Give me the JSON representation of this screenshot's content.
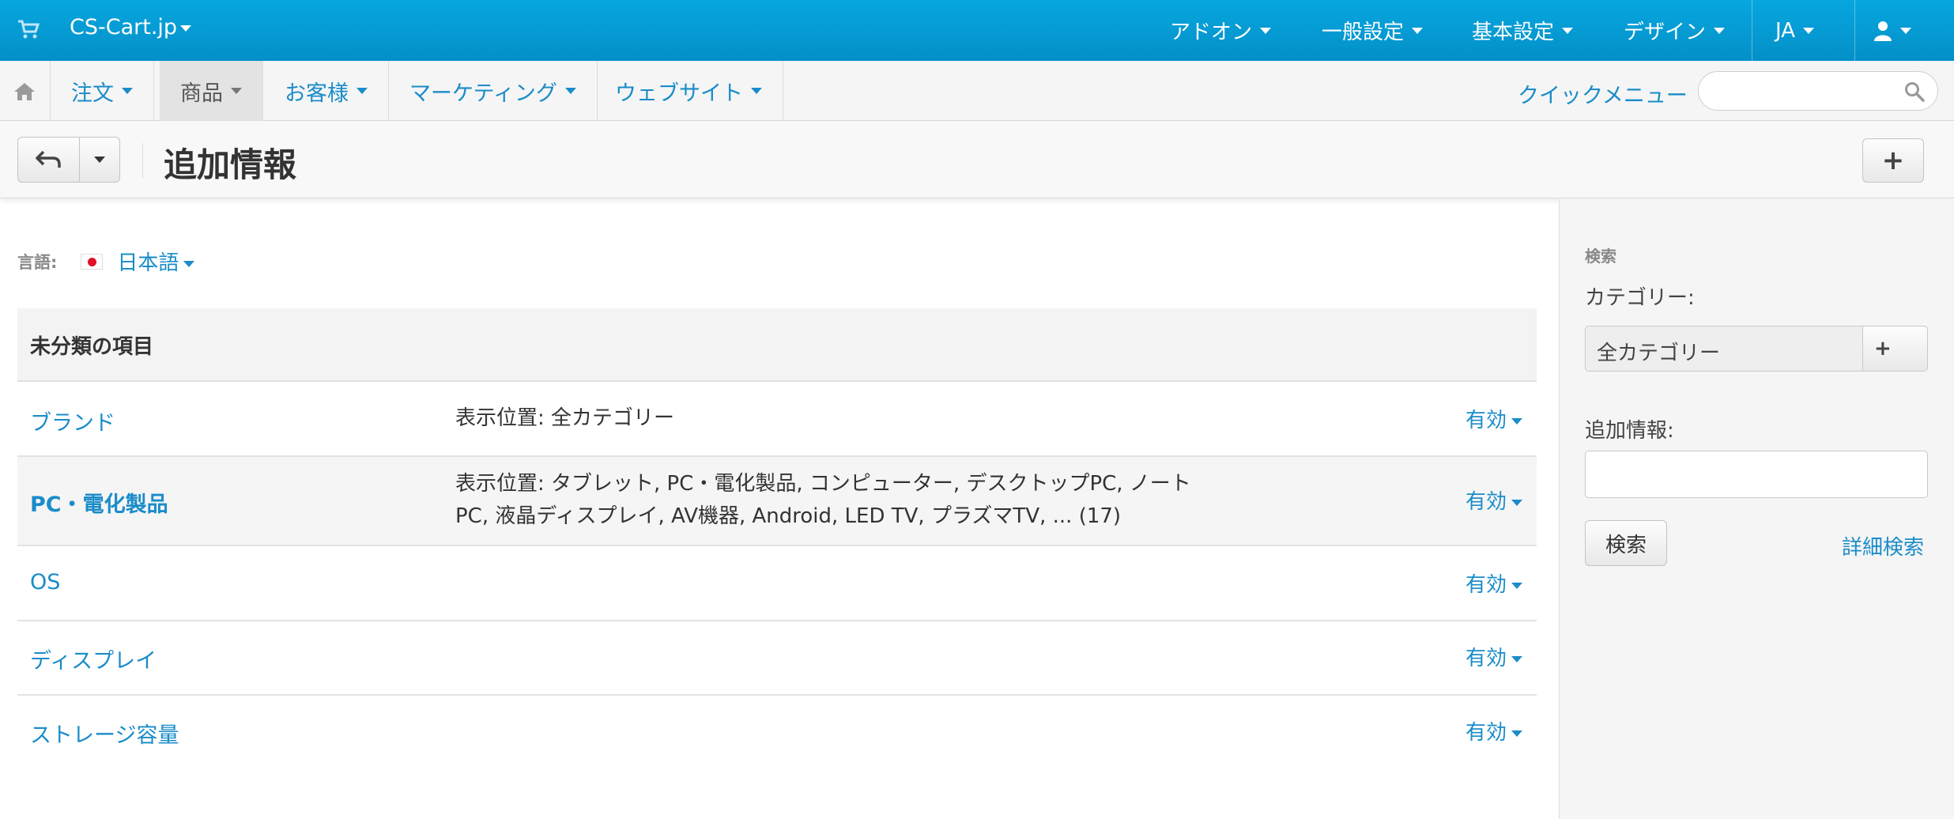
{
  "topbar": {
    "store_name": "CS-Cart.jp",
    "menu": [
      "アドオン",
      "一般設定",
      "基本設定",
      "デザイン"
    ],
    "language": "JA",
    "colors": {
      "bar": "#0490c8",
      "link": "#1a8cc9"
    }
  },
  "navbar": {
    "items": [
      "注文",
      "商品",
      "お客様",
      "マーケティング",
      "ウェブサイト"
    ],
    "active": "商品",
    "quick_menu": "クイックメニュー",
    "search_placeholder": ""
  },
  "page": {
    "title": "追加情報"
  },
  "language_selector": {
    "label": "言語:",
    "value": "日本語"
  },
  "group": {
    "header": "未分類の項目",
    "rows": [
      {
        "name": "ブランド",
        "position": "表示位置: 全カテゴリー",
        "status": "有効"
      },
      {
        "name": "PC・電化製品",
        "position": "表示位置: タブレット, PC・電化製品, コンピューター, デスクトップPC, ノートPC, 液晶ディスプレイ, AV機器, Android, LED TV, プラズマTV, ... (17)",
        "status": "有効"
      },
      {
        "name": "OS",
        "position": "",
        "status": "有効"
      },
      {
        "name": "ディスプレイ",
        "position": "",
        "status": "有効"
      },
      {
        "name": "ストレージ容量",
        "position": "",
        "status": "有効"
      }
    ]
  },
  "sidebar": {
    "heading": "検索",
    "category_label": "カテゴリー:",
    "category_value": "全カテゴリー",
    "feature_label": "追加情報:",
    "feature_value": "",
    "search_button": "検索",
    "advanced_link": "詳細検索"
  }
}
